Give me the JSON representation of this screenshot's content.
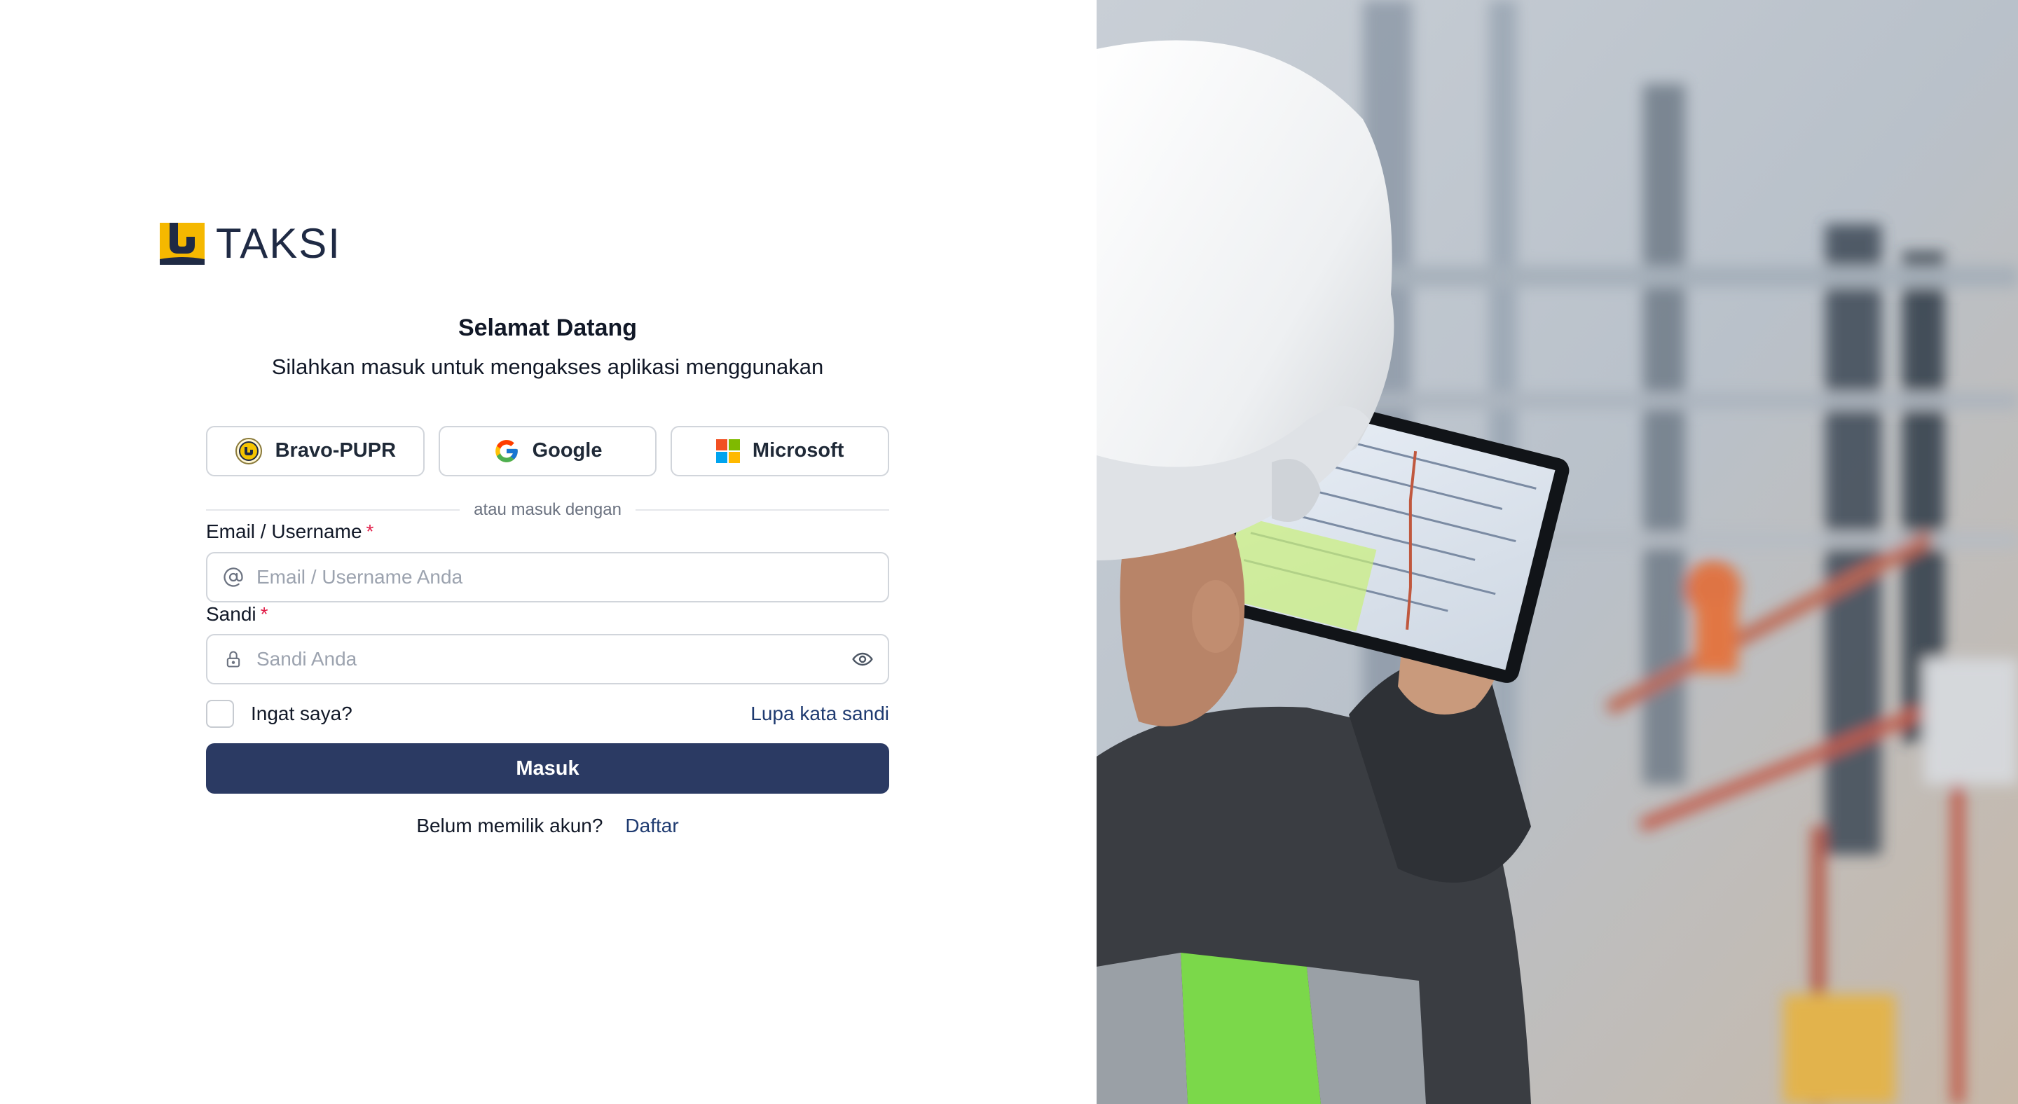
{
  "brand": {
    "name": "TAKSI",
    "colors": {
      "logo_yellow": "#f5b800",
      "logo_navy": "#1f2a44"
    }
  },
  "welcome": {
    "title": "Selamat Datang",
    "subtitle": "Silahkan masuk untuk mengakses aplikasi menggunakan"
  },
  "sso": [
    {
      "label": "Bravo-PUPR",
      "icon": "bravo-pupr-icon"
    },
    {
      "label": "Google",
      "icon": "google-icon"
    },
    {
      "label": "Microsoft",
      "icon": "microsoft-icon"
    }
  ],
  "divider_text": "atau masuk dengan",
  "form": {
    "email": {
      "label": "Email / Username",
      "required_mark": "*",
      "placeholder": "Email / Username Anda",
      "value": "",
      "icon": "at-icon"
    },
    "password": {
      "label": "Sandi",
      "required_mark": "*",
      "placeholder": "Sandi Anda",
      "value": "",
      "icon": "lock-icon",
      "toggle_icon": "eye-icon"
    },
    "remember_label": "Ingat saya?",
    "remember_checked": false,
    "forgot_label": "Lupa kata sandi",
    "submit_label": "Masuk"
  },
  "signup": {
    "text": "Belum memilik akun?",
    "link_label": "Daftar"
  },
  "theme": {
    "primary": "#2b3a63",
    "link": "#1e3a70",
    "required": "#e11d48",
    "border": "#d1d5db"
  },
  "hero_image": {
    "description_icon": "construction-worker-photo"
  }
}
